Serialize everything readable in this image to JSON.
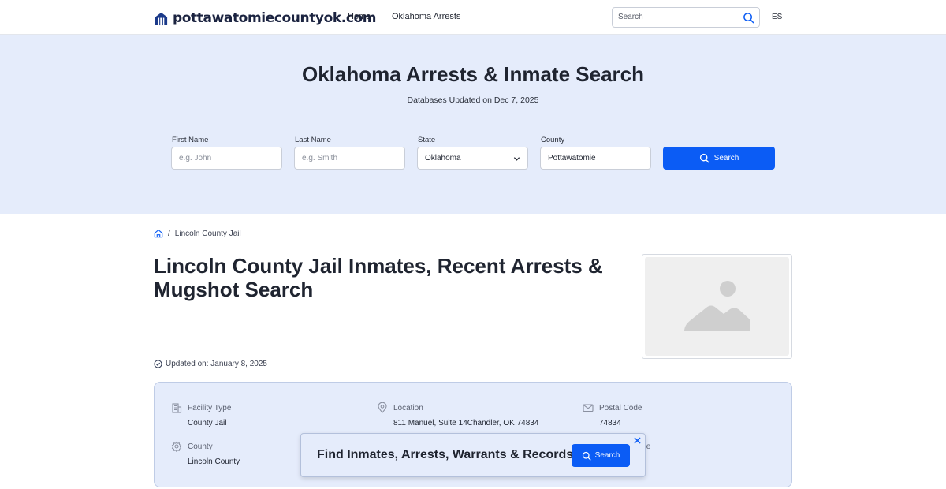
{
  "header": {
    "site_name": "pottawatomiecountyok.com",
    "nav": [
      "Home",
      "Oklahoma Arrests"
    ],
    "search_placeholder": "Search",
    "lang": "ES"
  },
  "hero": {
    "title": "Oklahoma Arrests & Inmate Search",
    "subtitle": "Databases Updated on Dec 7, 2025",
    "fields": {
      "first_name": {
        "label": "First Name",
        "placeholder": "e.g. John"
      },
      "last_name": {
        "label": "Last Name",
        "placeholder": "e.g. Smith"
      },
      "state": {
        "label": "State",
        "value": "Oklahoma"
      },
      "county": {
        "label": "County",
        "value": "Pottawatomie"
      }
    },
    "search_button": "Search"
  },
  "breadcrumb": {
    "separator": "/",
    "current": "Lincoln County Jail"
  },
  "page": {
    "title": "Lincoln County Jail Inmates, Recent Arrests & Mugshot Search",
    "updated": "Updated on: January 8, 2025"
  },
  "info": [
    {
      "icon": "building-icon",
      "label": "Facility Type",
      "value": "County Jail"
    },
    {
      "icon": "location-pin-icon",
      "label": "Location",
      "value": "811 Manuel, Suite 14Chandler, OK 74834"
    },
    {
      "icon": "envelope-icon",
      "label": "Postal Code",
      "value": "74834"
    },
    {
      "icon": "gear-icon",
      "label": "County",
      "value": "Lincoln County"
    },
    {
      "icon": "",
      "label": "te",
      "value": ""
    }
  ],
  "popup": {
    "text": "Find Inmates, Arrests, Warrants & Records",
    "button": "Search"
  },
  "colors": {
    "accent": "#0b5cf5",
    "hero_bg": "#e5ecfb",
    "text": "#1f2430"
  }
}
